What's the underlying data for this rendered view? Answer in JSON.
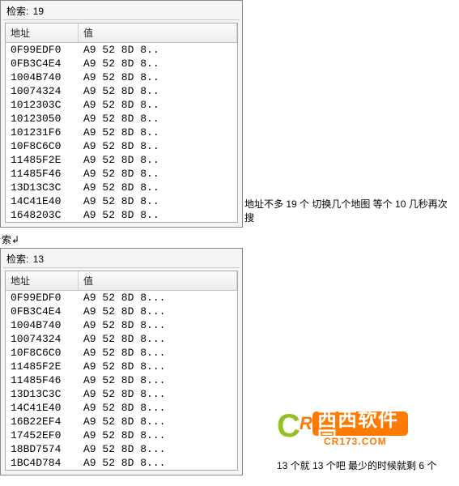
{
  "panel1": {
    "search_label": "检索:",
    "search_value": "19",
    "col_addr": "地址",
    "col_val": "值",
    "rows": [
      {
        "addr": "0F99EDF0",
        "val": "A9 52 8D 8.."
      },
      {
        "addr": "0FB3C4E4",
        "val": "A9 52 8D 8.."
      },
      {
        "addr": "1004B740",
        "val": "A9 52 8D 8.."
      },
      {
        "addr": "10074324",
        "val": "A9 52 8D 8.."
      },
      {
        "addr": "1012303C",
        "val": "A9 52 8D 8.."
      },
      {
        "addr": "10123050",
        "val": "A9 52 8D 8.."
      },
      {
        "addr": "101231F6",
        "val": "A9 52 8D 8.."
      },
      {
        "addr": "10F8C6C0",
        "val": "A9 52 8D 8.."
      },
      {
        "addr": "11485F2E",
        "val": "A9 52 8D 8.."
      },
      {
        "addr": "11485F46",
        "val": "A9 52 8D 8.."
      },
      {
        "addr": "13D13C3C",
        "val": "A9 52 8D 8.."
      },
      {
        "addr": "14C41E40",
        "val": "A9 52 8D 8.."
      },
      {
        "addr": "1648203C",
        "val": "A9 52 8D 8.."
      }
    ]
  },
  "annot1": "地址不多 19 个  切换几个地图 等个 10 几秒再次搜",
  "break_text": "索",
  "arrow": "↲",
  "panel2": {
    "search_label": "检索:",
    "search_value": "13",
    "col_addr": "地址",
    "col_val": "值",
    "rows": [
      {
        "addr": "0F99EDF0",
        "val": "A9 52 8D 8..."
      },
      {
        "addr": "0FB3C4E4",
        "val": "A9 52 8D 8..."
      },
      {
        "addr": "1004B740",
        "val": "A9 52 8D 8..."
      },
      {
        "addr": "10074324",
        "val": "A9 52 8D 8..."
      },
      {
        "addr": "10F8C6C0",
        "val": "A9 52 8D 8..."
      },
      {
        "addr": "11485F2E",
        "val": "A9 52 8D 8..."
      },
      {
        "addr": "11485F46",
        "val": "A9 52 8D 8..."
      },
      {
        "addr": "13D13C3C",
        "val": "A9 52 8D 8..."
      },
      {
        "addr": "14C41E40",
        "val": "A9 52 8D 8..."
      },
      {
        "addr": "16B22EF4",
        "val": "A9 52 8D 8..."
      },
      {
        "addr": "17452EF0",
        "val": "A9 52 8D 8..."
      },
      {
        "addr": "18BD7574",
        "val": "A9 52 8D 8..."
      },
      {
        "addr": "1BC4D784",
        "val": "A9 52 8D 8..."
      }
    ]
  },
  "annot2": "13 个就 13 个吧   最少的时候就剩 6 个",
  "logo": {
    "cn": "西西软件园",
    "url": "CR173.COM"
  }
}
